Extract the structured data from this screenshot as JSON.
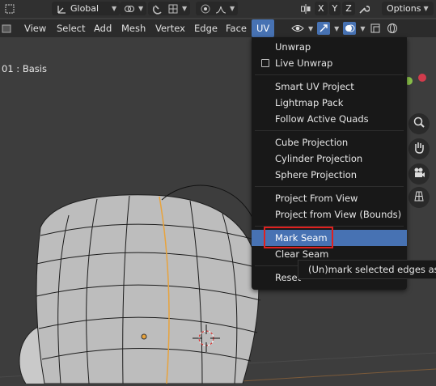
{
  "toolbar": {
    "orientation_label": "Global",
    "options_label": "Options",
    "axis_x": "X",
    "axis_y": "Y",
    "axis_z": "Z"
  },
  "menubar": {
    "items": [
      "View",
      "Select",
      "Add",
      "Mesh",
      "Vertex",
      "Edge",
      "Face",
      "UV"
    ]
  },
  "viewport": {
    "object_label": "01 : Basis"
  },
  "uv_menu": {
    "items": [
      {
        "label": "Unwrap"
      },
      {
        "label": "Live Unwrap"
      },
      {
        "label": "Smart UV Project"
      },
      {
        "label": "Lightmap Pack"
      },
      {
        "label": "Follow Active Quads"
      },
      {
        "label": "Cube Projection"
      },
      {
        "label": "Cylinder Projection"
      },
      {
        "label": "Sphere Projection"
      },
      {
        "label": "Project From View"
      },
      {
        "label": "Project from View (Bounds)"
      },
      {
        "label": "Mark Seam"
      },
      {
        "label": "Clear Seam"
      },
      {
        "label": "Reset"
      }
    ]
  },
  "tooltip": {
    "text": "(Un)mark selected edges as a seam."
  },
  "colors": {
    "accent": "#4772b3",
    "highlight_box": "#e0201e",
    "seam": "#e8a33c"
  }
}
